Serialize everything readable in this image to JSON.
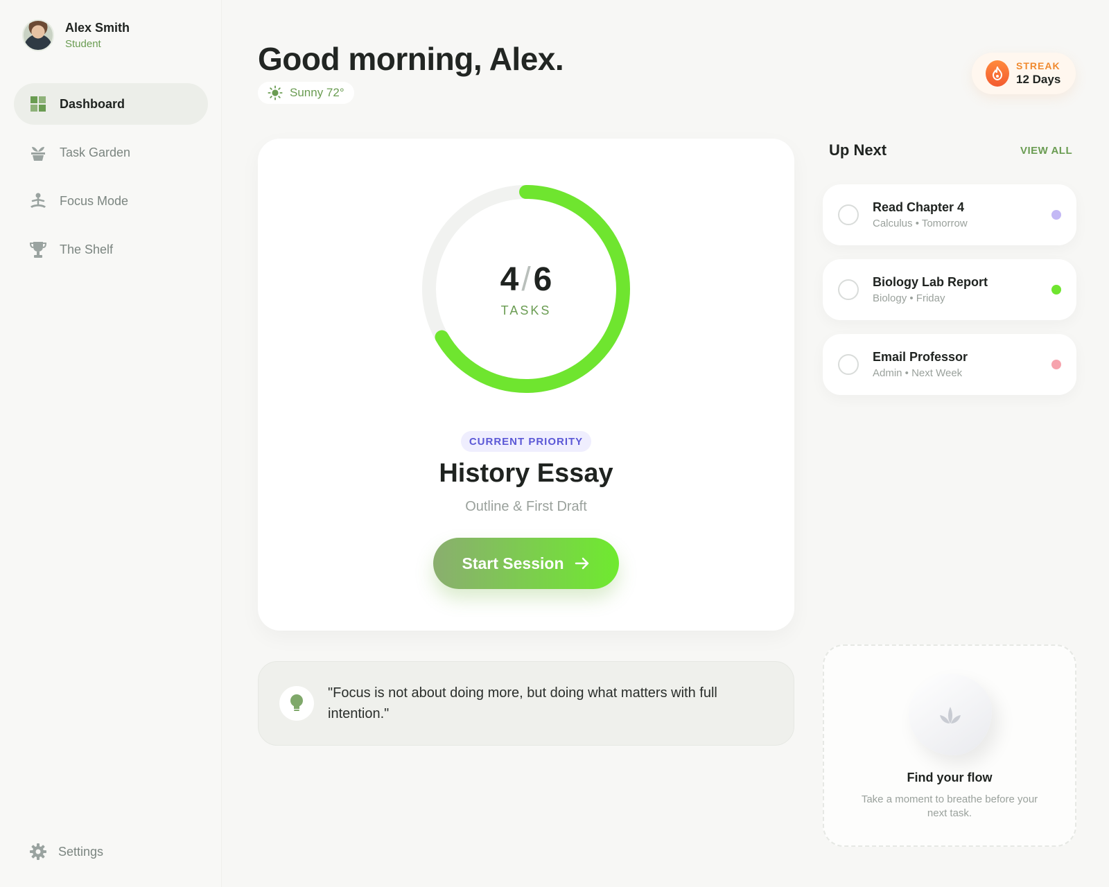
{
  "profile": {
    "name": "Alex Smith",
    "role": "Student"
  },
  "nav": {
    "items": [
      {
        "label": "Dashboard",
        "icon": "grid-icon",
        "active": true
      },
      {
        "label": "Task Garden",
        "icon": "plant-pot-icon",
        "active": false
      },
      {
        "label": "Focus Mode",
        "icon": "meditation-icon",
        "active": false
      },
      {
        "label": "The Shelf",
        "icon": "trophy-icon",
        "active": false
      }
    ],
    "settings_label": "Settings"
  },
  "header": {
    "greeting": "Good morning, Alex.",
    "weather": "Sunny 72°",
    "streak_label": "STREAK",
    "streak_value": "12 Days"
  },
  "priority": {
    "completed": "4",
    "total": "6",
    "progress_fraction": 0.667,
    "count_label": "TASKS",
    "badge": "CURRENT PRIORITY",
    "title": "History Essay",
    "subtitle": "Outline & First Draft",
    "button_label": "Start Session"
  },
  "quote": {
    "text": "\"Focus is not about doing more, but doing what matters with full intention.\""
  },
  "up_next": {
    "title": "Up Next",
    "view_all": "VIEW ALL",
    "items": [
      {
        "title": "Read Chapter 4",
        "meta": "Calculus • Tomorrow",
        "color": "#c3b8f5"
      },
      {
        "title": "Biology Lab Report",
        "meta": "Biology • Friday",
        "color": "#6fe52f"
      },
      {
        "title": "Email Professor",
        "meta": "Admin • Next Week",
        "color": "#f6a3ad"
      }
    ]
  },
  "flow": {
    "title": "Find your flow",
    "text": "Take a moment to breathe before your next task."
  },
  "colors": {
    "accent": "#6fe52f",
    "accent_dark": "#6a9c52",
    "priority_badge": "#5b58d6",
    "streak": "#f08a2f"
  }
}
